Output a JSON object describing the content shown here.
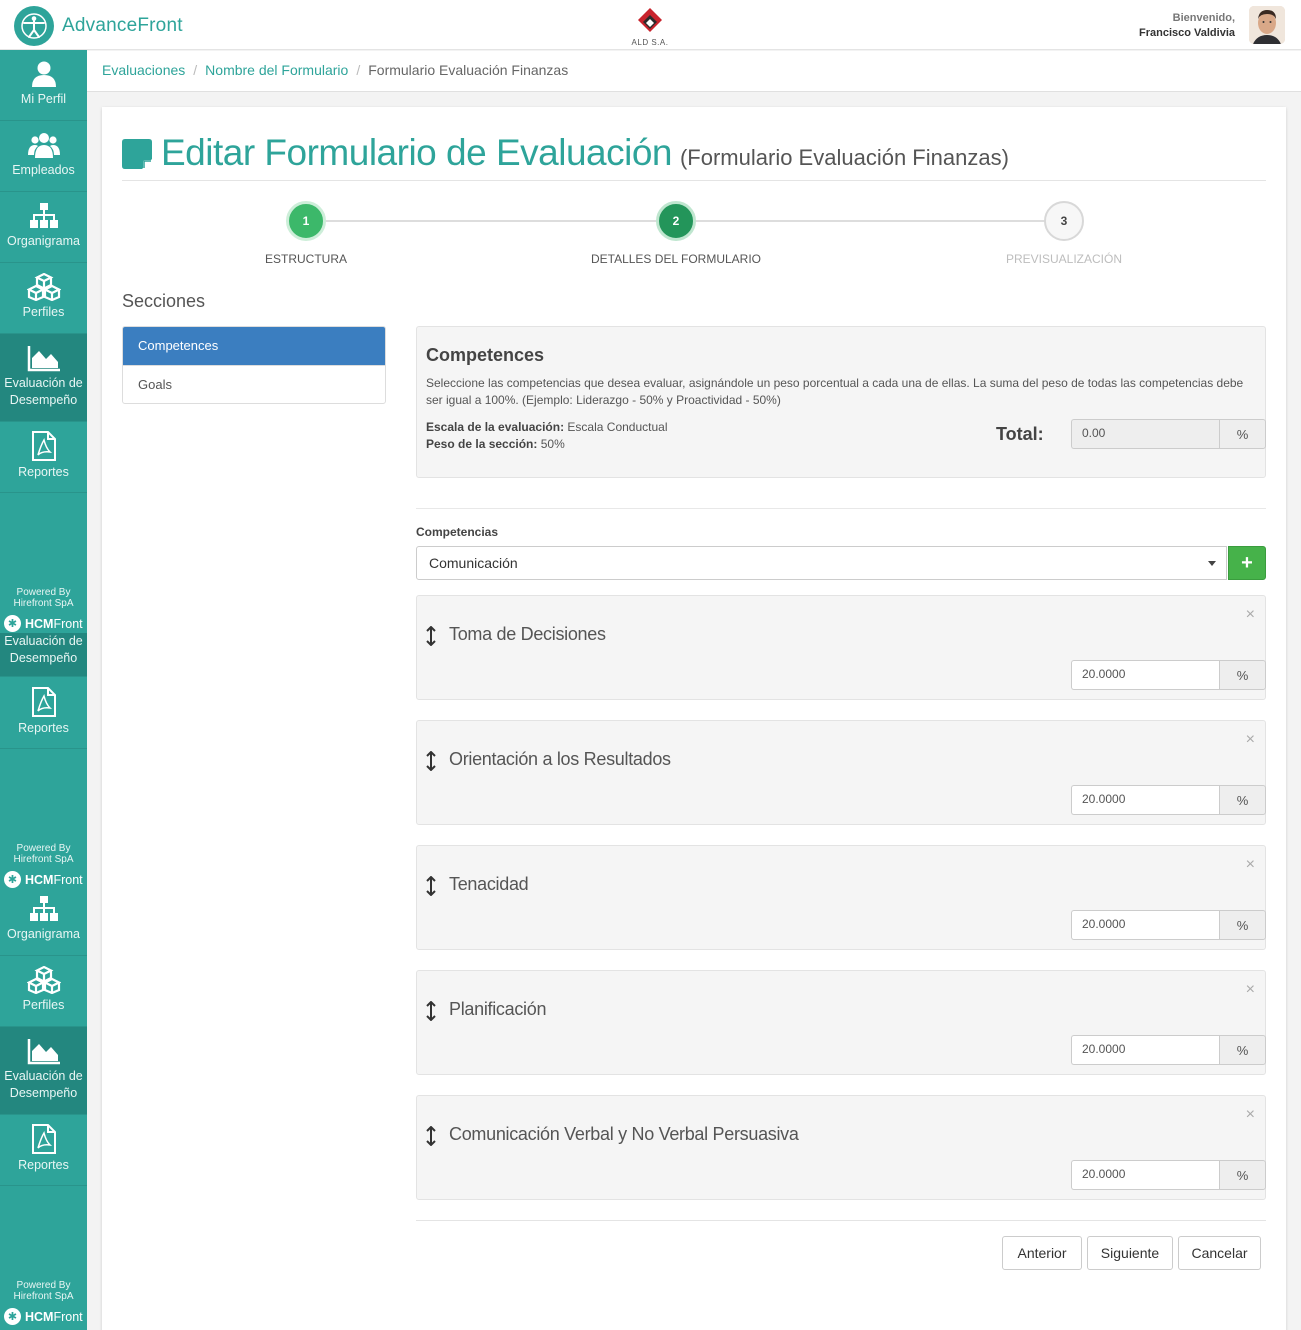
{
  "header": {
    "brand_name": "AdvanceFront",
    "client_logo_text": "ALD S.A.",
    "welcome": "Bienvenido,",
    "user_name": "Francisco Valdivia"
  },
  "sidebar": {
    "items": [
      {
        "label": "Mi Perfil",
        "icon": "user-icon"
      },
      {
        "label": "Empleados",
        "icon": "users-icon"
      },
      {
        "label": "Organigrama",
        "icon": "sitemap-icon"
      },
      {
        "label": "Perfiles",
        "icon": "cubes-icon"
      },
      {
        "label": "Evaluación de Desempeño",
        "icon": "area-chart-icon"
      },
      {
        "label": "Reportes",
        "icon": "pdf-file-icon"
      }
    ],
    "powered_by": "Powered By",
    "powered_company": "Hirefront SpA",
    "hcm_bold": "HCM",
    "hcm_rest": "Front"
  },
  "breadcrumb": {
    "items": [
      "Evaluaciones",
      "Nombre del Formulario",
      "Formulario Evaluación Finanzas"
    ],
    "separator": "/"
  },
  "page": {
    "title": "Editar Formulario de Evaluación",
    "subtitle": "(Formulario Evaluación Finanzas)"
  },
  "steps": [
    {
      "number": "1",
      "label": "ESTRUCTURA",
      "state": "done"
    },
    {
      "number": "2",
      "label": "DETALLES DEL FORMULARIO",
      "state": "current"
    },
    {
      "number": "3",
      "label": "PREVISUALIZACIÓN",
      "state": "pending"
    }
  ],
  "sections": {
    "title": "Secciones",
    "items": [
      "Competences",
      "Goals"
    ],
    "active_index": 0
  },
  "info": {
    "heading": "Competences",
    "description": "Seleccione las competencias que desea evaluar, asignándole un peso porcentual a cada una de ellas. La suma del peso de todas las competencias debe ser igual a 100%. (Ejemplo: Liderazgo - 50% y Proactividad - 50%)",
    "scale_label": "Escala de la evaluación:",
    "scale_value": "Escala Conductual",
    "weight_label": "Peso de la sección:",
    "weight_value": "50%",
    "total_label": "Total:",
    "total_value": "0.00",
    "percent_addon": "%"
  },
  "competencias": {
    "label": "Competencias",
    "selected": "Comunicación",
    "add_button": "+",
    "items": [
      {
        "name": "Toma de Decisiones",
        "weight": "20.0000"
      },
      {
        "name": "Orientación a los Resultados",
        "weight": "20.0000"
      },
      {
        "name": "Tenacidad",
        "weight": "20.0000"
      },
      {
        "name": "Planificación",
        "weight": "20.0000"
      },
      {
        "name": "Comunicación Verbal y No Verbal Persuasiva",
        "weight": "20.0000"
      }
    ],
    "remove_glyph": "×",
    "percent_addon": "%"
  },
  "footer_buttons": {
    "previous": "Anterior",
    "next": "Siguiente",
    "cancel": "Cancelar"
  },
  "colors": {
    "brand": "#2ea49a",
    "active_section": "#3b7ec0",
    "add_button": "#46b24a",
    "step_done": "#3cb86a"
  }
}
